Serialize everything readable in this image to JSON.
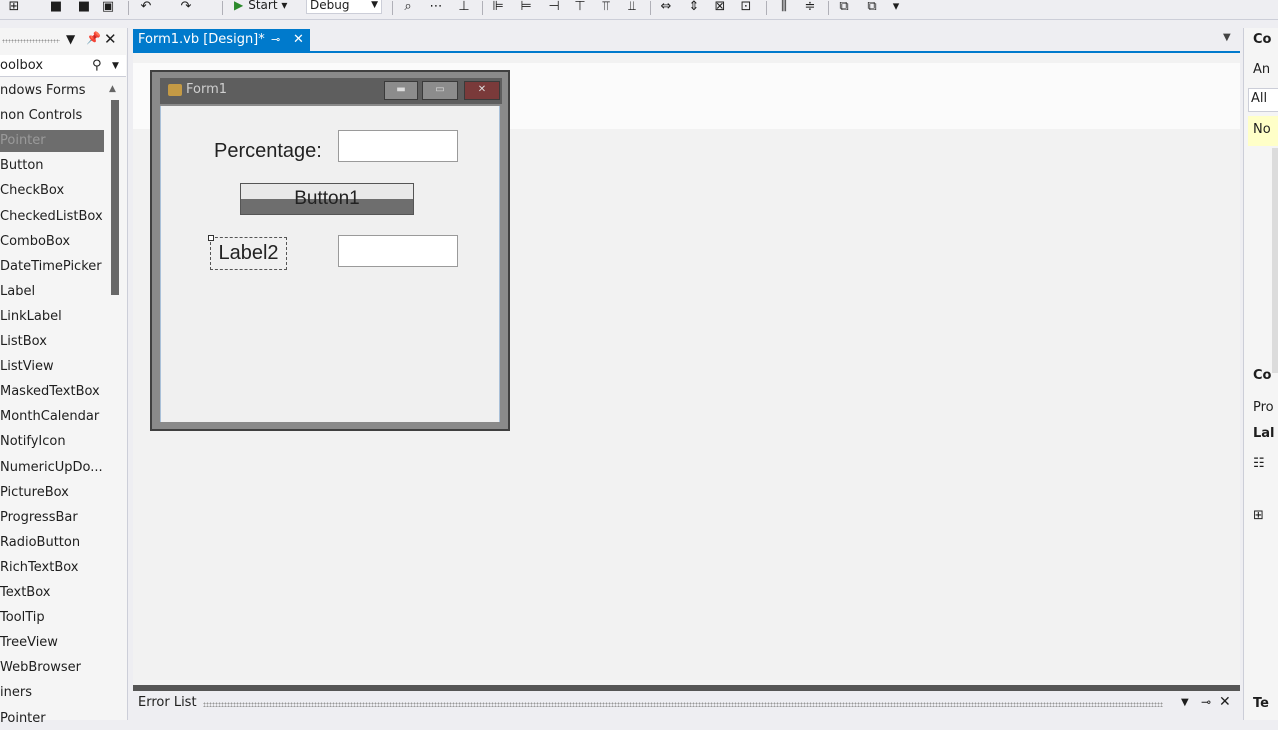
{
  "toolbar": {
    "start_label": "Start",
    "config_value": "Debug"
  },
  "toolbox": {
    "title": "oolbox",
    "items": [
      {
        "label": "ndows Forms"
      },
      {
        "label": "non Controls"
      },
      {
        "label": "Pointer"
      },
      {
        "label": "Button"
      },
      {
        "label": "CheckBox"
      },
      {
        "label": "CheckedListBox"
      },
      {
        "label": "ComboBox"
      },
      {
        "label": "DateTimePicker"
      },
      {
        "label": "Label"
      },
      {
        "label": "LinkLabel"
      },
      {
        "label": "ListBox"
      },
      {
        "label": "ListView"
      },
      {
        "label": "MaskedTextBox"
      },
      {
        "label": "MonthCalendar"
      },
      {
        "label": "NotifyIcon"
      },
      {
        "label": "NumericUpDo..."
      },
      {
        "label": "PictureBox"
      },
      {
        "label": "ProgressBar"
      },
      {
        "label": "RadioButton"
      },
      {
        "label": "RichTextBox"
      },
      {
        "label": "TextBox"
      },
      {
        "label": "ToolTip"
      },
      {
        "label": "TreeView"
      },
      {
        "label": "WebBrowser"
      },
      {
        "label": "iners"
      },
      {
        "label": "Pointer"
      }
    ]
  },
  "doc_tab": {
    "label": "Form1.vb [Design]*"
  },
  "form": {
    "title": "Form1",
    "percentage_label": "Percentage:",
    "button_label": "Button1",
    "label2": "Label2"
  },
  "error_list": {
    "title": "Error List"
  },
  "right_panel": {
    "t1": "Co",
    "t2": "An",
    "t3": "All",
    "t4": "No",
    "t5": "Co",
    "t6": "Pro",
    "t7": "Lal",
    "t8": "Te"
  },
  "colors": {
    "accent": "#007acc",
    "selection": "#6d6d6d"
  }
}
